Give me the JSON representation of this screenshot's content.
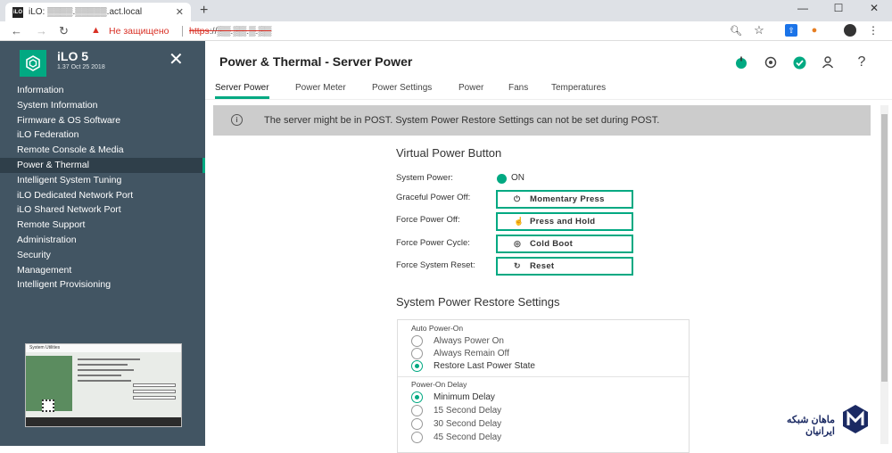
{
  "browser": {
    "tab_title": "iLO: ▒▒▒▒.▒▒▒▒▒.act.local",
    "tab_favicon": "iLO",
    "new_tab": "+",
    "security_label": "Не защищено",
    "url_scheme": "https",
    "url_rest": "://▒▒.▒▒.▒.▒▒",
    "win_min": "—",
    "win_max": "☐",
    "win_close": "✕"
  },
  "sidebar": {
    "brand": "iLO 5",
    "version": "1.37 Oct 25 2018",
    "items": [
      "Information",
      "System Information",
      "Firmware & OS Software",
      "iLO Federation",
      "Remote Console & Media",
      "Power & Thermal",
      "Intelligent System Tuning",
      "iLO Dedicated Network Port",
      "iLO Shared Network Port",
      "Remote Support",
      "Administration",
      "Security",
      "Management",
      "Intelligent Provisioning"
    ],
    "active_index": 5,
    "thumbnail_title": "System Utilities"
  },
  "main": {
    "title": "Power & Thermal - Server Power",
    "tabs": [
      "Server Power",
      "Power Meter",
      "Power Settings",
      "Power",
      "Fans",
      "Temperatures"
    ],
    "active_tab": 0,
    "notice": "The server might be in POST. System Power Restore Settings can not be set during POST.",
    "virtual_power": {
      "heading": "Virtual Power Button",
      "system_power_label": "System Power:",
      "system_power_value": "ON",
      "rows": [
        {
          "label": "Graceful Power Off:",
          "button": "Momentary Press",
          "icon": "power-icon"
        },
        {
          "label": "Force Power Off:",
          "button": "Press and Hold",
          "icon": "hand-press-icon"
        },
        {
          "label": "Force Power Cycle:",
          "button": "Cold Boot",
          "icon": "cycle-icon"
        },
        {
          "label": "Force System Reset:",
          "button": "Reset",
          "icon": "reset-icon"
        }
      ]
    },
    "restore": {
      "heading": "System Power Restore Settings",
      "auto_power_on": {
        "label": "Auto Power-On",
        "options": [
          "Always Power On",
          "Always Remain Off",
          "Restore Last Power State"
        ],
        "selected": 2
      },
      "power_on_delay": {
        "label": "Power-On Delay",
        "options": [
          "Minimum Delay",
          "15 Second Delay",
          "30 Second Delay",
          "45 Second Delay"
        ],
        "selected": 0
      }
    }
  },
  "watermark": {
    "text": "ماهان شبکه ایرانیان"
  },
  "colors": {
    "accent": "#01a982",
    "sidebar": "#425563",
    "notice_bg": "#cccccc"
  }
}
